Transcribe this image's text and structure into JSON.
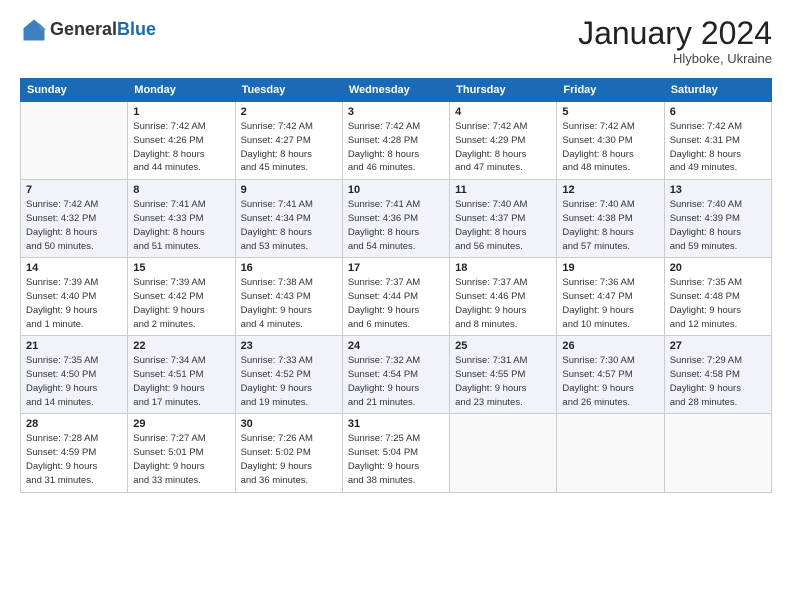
{
  "header": {
    "logo_general": "General",
    "logo_blue": "Blue",
    "month_title": "January 2024",
    "location": "Hlyboke, Ukraine"
  },
  "weekdays": [
    "Sunday",
    "Monday",
    "Tuesday",
    "Wednesday",
    "Thursday",
    "Friday",
    "Saturday"
  ],
  "weeks": [
    [
      {
        "day": "",
        "info": ""
      },
      {
        "day": "1",
        "info": "Sunrise: 7:42 AM\nSunset: 4:26 PM\nDaylight: 8 hours\nand 44 minutes."
      },
      {
        "day": "2",
        "info": "Sunrise: 7:42 AM\nSunset: 4:27 PM\nDaylight: 8 hours\nand 45 minutes."
      },
      {
        "day": "3",
        "info": "Sunrise: 7:42 AM\nSunset: 4:28 PM\nDaylight: 8 hours\nand 46 minutes."
      },
      {
        "day": "4",
        "info": "Sunrise: 7:42 AM\nSunset: 4:29 PM\nDaylight: 8 hours\nand 47 minutes."
      },
      {
        "day": "5",
        "info": "Sunrise: 7:42 AM\nSunset: 4:30 PM\nDaylight: 8 hours\nand 48 minutes."
      },
      {
        "day": "6",
        "info": "Sunrise: 7:42 AM\nSunset: 4:31 PM\nDaylight: 8 hours\nand 49 minutes."
      }
    ],
    [
      {
        "day": "7",
        "info": "Sunrise: 7:42 AM\nSunset: 4:32 PM\nDaylight: 8 hours\nand 50 minutes."
      },
      {
        "day": "8",
        "info": "Sunrise: 7:41 AM\nSunset: 4:33 PM\nDaylight: 8 hours\nand 51 minutes."
      },
      {
        "day": "9",
        "info": "Sunrise: 7:41 AM\nSunset: 4:34 PM\nDaylight: 8 hours\nand 53 minutes."
      },
      {
        "day": "10",
        "info": "Sunrise: 7:41 AM\nSunset: 4:36 PM\nDaylight: 8 hours\nand 54 minutes."
      },
      {
        "day": "11",
        "info": "Sunrise: 7:40 AM\nSunset: 4:37 PM\nDaylight: 8 hours\nand 56 minutes."
      },
      {
        "day": "12",
        "info": "Sunrise: 7:40 AM\nSunset: 4:38 PM\nDaylight: 8 hours\nand 57 minutes."
      },
      {
        "day": "13",
        "info": "Sunrise: 7:40 AM\nSunset: 4:39 PM\nDaylight: 8 hours\nand 59 minutes."
      }
    ],
    [
      {
        "day": "14",
        "info": "Sunrise: 7:39 AM\nSunset: 4:40 PM\nDaylight: 9 hours\nand 1 minute."
      },
      {
        "day": "15",
        "info": "Sunrise: 7:39 AM\nSunset: 4:42 PM\nDaylight: 9 hours\nand 2 minutes."
      },
      {
        "day": "16",
        "info": "Sunrise: 7:38 AM\nSunset: 4:43 PM\nDaylight: 9 hours\nand 4 minutes."
      },
      {
        "day": "17",
        "info": "Sunrise: 7:37 AM\nSunset: 4:44 PM\nDaylight: 9 hours\nand 6 minutes."
      },
      {
        "day": "18",
        "info": "Sunrise: 7:37 AM\nSunset: 4:46 PM\nDaylight: 9 hours\nand 8 minutes."
      },
      {
        "day": "19",
        "info": "Sunrise: 7:36 AM\nSunset: 4:47 PM\nDaylight: 9 hours\nand 10 minutes."
      },
      {
        "day": "20",
        "info": "Sunrise: 7:35 AM\nSunset: 4:48 PM\nDaylight: 9 hours\nand 12 minutes."
      }
    ],
    [
      {
        "day": "21",
        "info": "Sunrise: 7:35 AM\nSunset: 4:50 PM\nDaylight: 9 hours\nand 14 minutes."
      },
      {
        "day": "22",
        "info": "Sunrise: 7:34 AM\nSunset: 4:51 PM\nDaylight: 9 hours\nand 17 minutes."
      },
      {
        "day": "23",
        "info": "Sunrise: 7:33 AM\nSunset: 4:52 PM\nDaylight: 9 hours\nand 19 minutes."
      },
      {
        "day": "24",
        "info": "Sunrise: 7:32 AM\nSunset: 4:54 PM\nDaylight: 9 hours\nand 21 minutes."
      },
      {
        "day": "25",
        "info": "Sunrise: 7:31 AM\nSunset: 4:55 PM\nDaylight: 9 hours\nand 23 minutes."
      },
      {
        "day": "26",
        "info": "Sunrise: 7:30 AM\nSunset: 4:57 PM\nDaylight: 9 hours\nand 26 minutes."
      },
      {
        "day": "27",
        "info": "Sunrise: 7:29 AM\nSunset: 4:58 PM\nDaylight: 9 hours\nand 28 minutes."
      }
    ],
    [
      {
        "day": "28",
        "info": "Sunrise: 7:28 AM\nSunset: 4:59 PM\nDaylight: 9 hours\nand 31 minutes."
      },
      {
        "day": "29",
        "info": "Sunrise: 7:27 AM\nSunset: 5:01 PM\nDaylight: 9 hours\nand 33 minutes."
      },
      {
        "day": "30",
        "info": "Sunrise: 7:26 AM\nSunset: 5:02 PM\nDaylight: 9 hours\nand 36 minutes."
      },
      {
        "day": "31",
        "info": "Sunrise: 7:25 AM\nSunset: 5:04 PM\nDaylight: 9 hours\nand 38 minutes."
      },
      {
        "day": "",
        "info": ""
      },
      {
        "day": "",
        "info": ""
      },
      {
        "day": "",
        "info": ""
      }
    ]
  ]
}
